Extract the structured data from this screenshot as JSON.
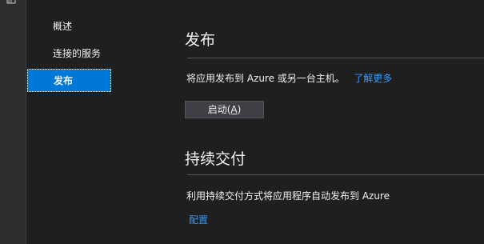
{
  "nav": {
    "items": [
      {
        "label": "概述",
        "selected": false
      },
      {
        "label": "连接的服务",
        "selected": false
      },
      {
        "label": "发布",
        "selected": true
      }
    ]
  },
  "publish": {
    "title": "发布",
    "description": "将应用发布到 Azure 或另一台主机。",
    "learn_more": "了解更多",
    "button_label_prefix": "启动(",
    "button_label_accel": "A",
    "button_label_suffix": ")"
  },
  "continuous_delivery": {
    "title": "持续交付",
    "description": "利用持续交付方式将应用程序自动发布到 Azure",
    "configure_link": "配置"
  },
  "colors": {
    "accent": "#0078d7",
    "link": "#3399ff",
    "background": "#1f1f20",
    "button": "#3f3f46"
  }
}
